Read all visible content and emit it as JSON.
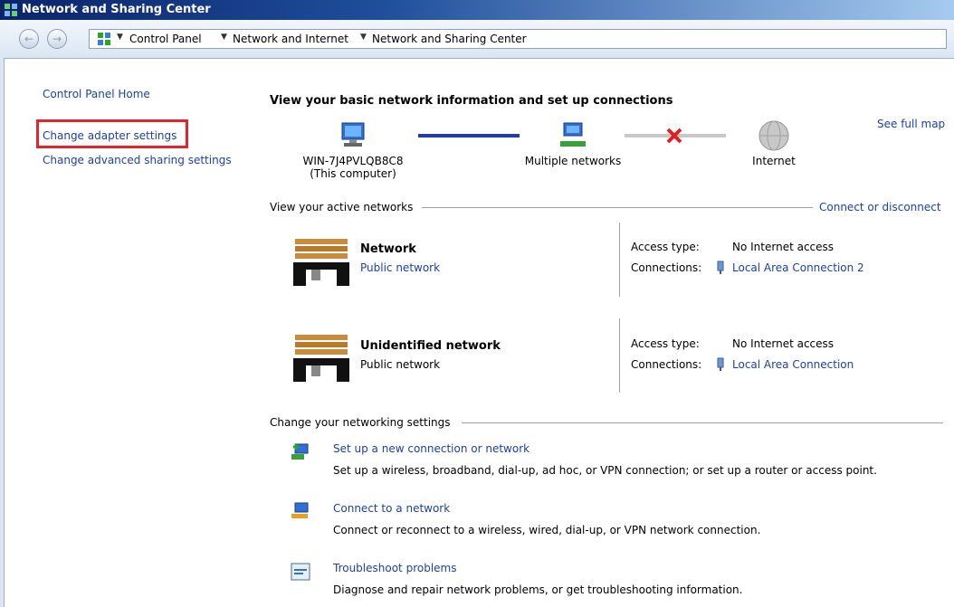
{
  "window": {
    "title": "Network and Sharing Center"
  },
  "breadcrumb": {
    "items": [
      "Control Panel",
      "Network and Internet",
      "Network and Sharing Center"
    ]
  },
  "sidebar": {
    "items": [
      {
        "label": "Control Panel Home"
      },
      {
        "label": "Change adapter settings"
      },
      {
        "label": "Change advanced sharing settings"
      }
    ]
  },
  "main": {
    "heading": "View your basic network information and set up connections",
    "see_full_map": "See full map",
    "map": {
      "computer_name": "WIN-7J4PVLQB8C8",
      "computer_sub": "(This computer)",
      "networks": "Multiple networks",
      "internet": "Internet"
    },
    "active_networks": {
      "label": "View your active networks",
      "connect_link": "Connect or disconnect",
      "access_type_label": "Access type:",
      "connections_label": "Connections:",
      "networks": [
        {
          "name": "Network",
          "type": "Public network",
          "access": "No Internet access",
          "connection": "Local Area Connection 2"
        },
        {
          "name": "Unidentified network",
          "type": "Public network",
          "access": "No Internet access",
          "connection": "Local Area Connection"
        }
      ]
    },
    "settings": {
      "label": "Change your networking settings",
      "tasks": [
        {
          "title": "Set up a new connection or network",
          "desc": "Set up a wireless, broadband, dial-up, ad hoc, or VPN connection; or set up a router or access point."
        },
        {
          "title": "Connect to a network",
          "desc": "Connect or reconnect to a wireless, wired, dial-up, or VPN network connection."
        },
        {
          "title": "Troubleshoot problems",
          "desc": "Diagnose and repair network problems, or get troubleshooting information."
        }
      ]
    }
  },
  "colors": {
    "link": "#1a3fb0",
    "highlight": "#e2242b",
    "titlebar": "#0a246a",
    "network_line": "#1f3fa8",
    "error_x": "#e02020"
  }
}
